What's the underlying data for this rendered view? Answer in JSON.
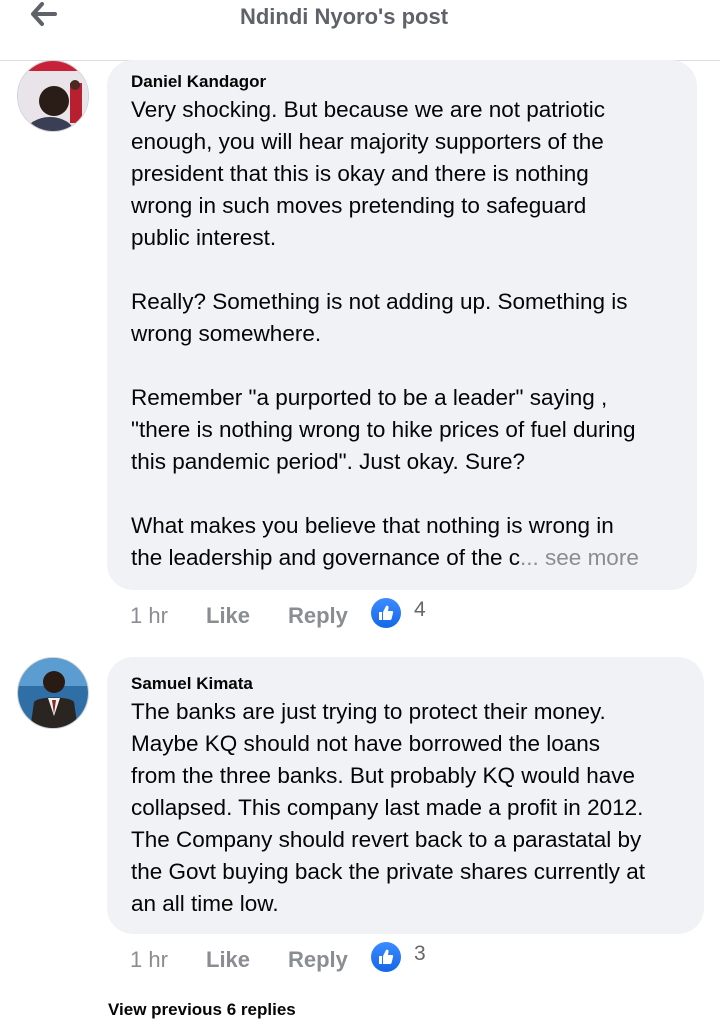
{
  "header": {
    "title": "Ndindi Nyoro's post"
  },
  "comments": [
    {
      "author": "Daniel Kandagor",
      "text": "Very shocking. But because we are not patriotic\nenough, you will hear majority supporters of the\npresident that this is okay and there is nothing\nwrong in such moves pretending to safeguard\npublic interest.\n\nReally? Something is not adding up. Something is\nwrong somewhere.\n\nRemember \"a purported to be a leader\" saying ,\n\"there is nothing wrong to hike prices of fuel during\nthis pandemic period\". Just okay. Sure?\n\nWhat makes you believe that nothing is wrong in\nthe leadership and governance of the c",
      "see_more": "... see more",
      "time": "1 hr",
      "like_label": "Like",
      "reply_label": "Reply",
      "reaction_count": "4"
    },
    {
      "author": "Samuel Kimata",
      "text": "The banks are just trying to protect their money.\nMaybe KQ  should not have borrowed the loans\nfrom the three banks. But probably KQ would have\ncollapsed. This company last made a profit in 2012.\nThe Company should revert back to a parastatal by\nthe Govt buying back the private shares currently at\nan all time low.",
      "time": "1 hr",
      "like_label": "Like",
      "reply_label": "Reply",
      "reaction_count": "3"
    }
  ],
  "view_previous": "View previous 6 replies",
  "colors": {
    "bubble": "#f0f2f5",
    "meta_text": "#8a8d91",
    "like_icon": "#1467e8"
  }
}
